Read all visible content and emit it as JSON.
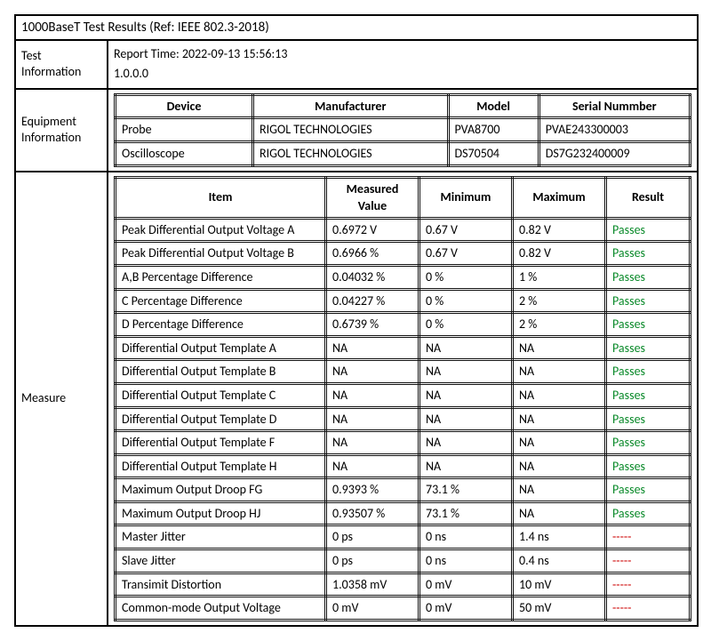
{
  "title": "1000BaseT Test Results (Ref: IEEE 802.3-2018)",
  "sections": {
    "test_information": {
      "label": "Test Information",
      "lines": [
        "Report Time: 2022-09-13 15:56:13",
        "1.0.0.0"
      ]
    },
    "equipment_information": {
      "label": "Equipment Information",
      "headers": [
        "Device",
        "Manufacturer",
        "Model",
        "Serial Nummber"
      ],
      "rows": [
        [
          "Probe",
          "RIGOL TECHNOLOGIES",
          "PVA8700",
          "PVAE243300003"
        ],
        [
          "Oscilloscope",
          "RIGOL TECHNOLOGIES",
          "DS70504",
          "DS7G232400009"
        ]
      ]
    },
    "measure": {
      "label": "Measure",
      "headers": [
        "Item",
        "Measured Value",
        "Minimum",
        "Maximum",
        "Result"
      ],
      "rows": [
        {
          "item": "Peak Differential Output Voltage A",
          "measured": "0.6972 V",
          "min": "0.67 V",
          "max": "0.82 V",
          "result": "Passes",
          "rclass": "pass"
        },
        {
          "item": "Peak Differential Output Voltage B",
          "measured": "0.6966 %",
          "min": "0.67 V",
          "max": "0.82 V",
          "result": "Passes",
          "rclass": "pass"
        },
        {
          "item": "A,B Percentage Difference",
          "measured": "0.04032 %",
          "min": "0 %",
          "max": "1 %",
          "result": "Passes",
          "rclass": "pass"
        },
        {
          "item": "C Percentage Difference",
          "measured": "0.04227 %",
          "min": "0 %",
          "max": "2 %",
          "result": "Passes",
          "rclass": "pass"
        },
        {
          "item": "D Percentage Difference",
          "measured": "0.6739 %",
          "min": "0 %",
          "max": "2 %",
          "result": "Passes",
          "rclass": "pass"
        },
        {
          "item": "Differential Output Template A",
          "measured": "NA",
          "min": "NA",
          "max": "NA",
          "result": "Passes",
          "rclass": "pass"
        },
        {
          "item": "Differential Output Template B",
          "measured": "NA",
          "min": "NA",
          "max": "NA",
          "result": "Passes",
          "rclass": "pass"
        },
        {
          "item": "Differential Output Template C",
          "measured": "NA",
          "min": "NA",
          "max": "NA",
          "result": "Passes",
          "rclass": "pass"
        },
        {
          "item": "Differential Output Template D",
          "measured": "NA",
          "min": "NA",
          "max": "NA",
          "result": "Passes",
          "rclass": "pass"
        },
        {
          "item": "Differential Output Template F",
          "measured": "NA",
          "min": "NA",
          "max": "NA",
          "result": "Passes",
          "rclass": "pass"
        },
        {
          "item": "Differential Output Template H",
          "measured": "NA",
          "min": "NA",
          "max": "NA",
          "result": "Passes",
          "rclass": "pass"
        },
        {
          "item": "Maximum Output Droop FG",
          "measured": "0.9393 %",
          "min": "73.1 %",
          "max": "NA",
          "result": "Passes",
          "rclass": "pass"
        },
        {
          "item": "Maximum Output Droop HJ",
          "measured": "0.93507 %",
          "min": "73.1 %",
          "max": "NA",
          "result": "Passes",
          "rclass": "pass"
        },
        {
          "item": "Master Jitter",
          "measured": "0 ps",
          "min": "0 ns",
          "max": "1.4 ns",
          "result": "-----",
          "rclass": "dash"
        },
        {
          "item": "Slave Jitter",
          "measured": "0 ps",
          "min": "0 ns",
          "max": "0.4 ns",
          "result": "-----",
          "rclass": "dash"
        },
        {
          "item": "Transimit Distortion",
          "measured": "1.0358 mV",
          "min": "0 mV",
          "max": "10 mV",
          "result": "-----",
          "rclass": "dash"
        },
        {
          "item": "Common-mode Output Voltage",
          "measured": "0 mV",
          "min": "0 mV",
          "max": "50 mV",
          "result": "-----",
          "rclass": "dash"
        }
      ]
    }
  }
}
